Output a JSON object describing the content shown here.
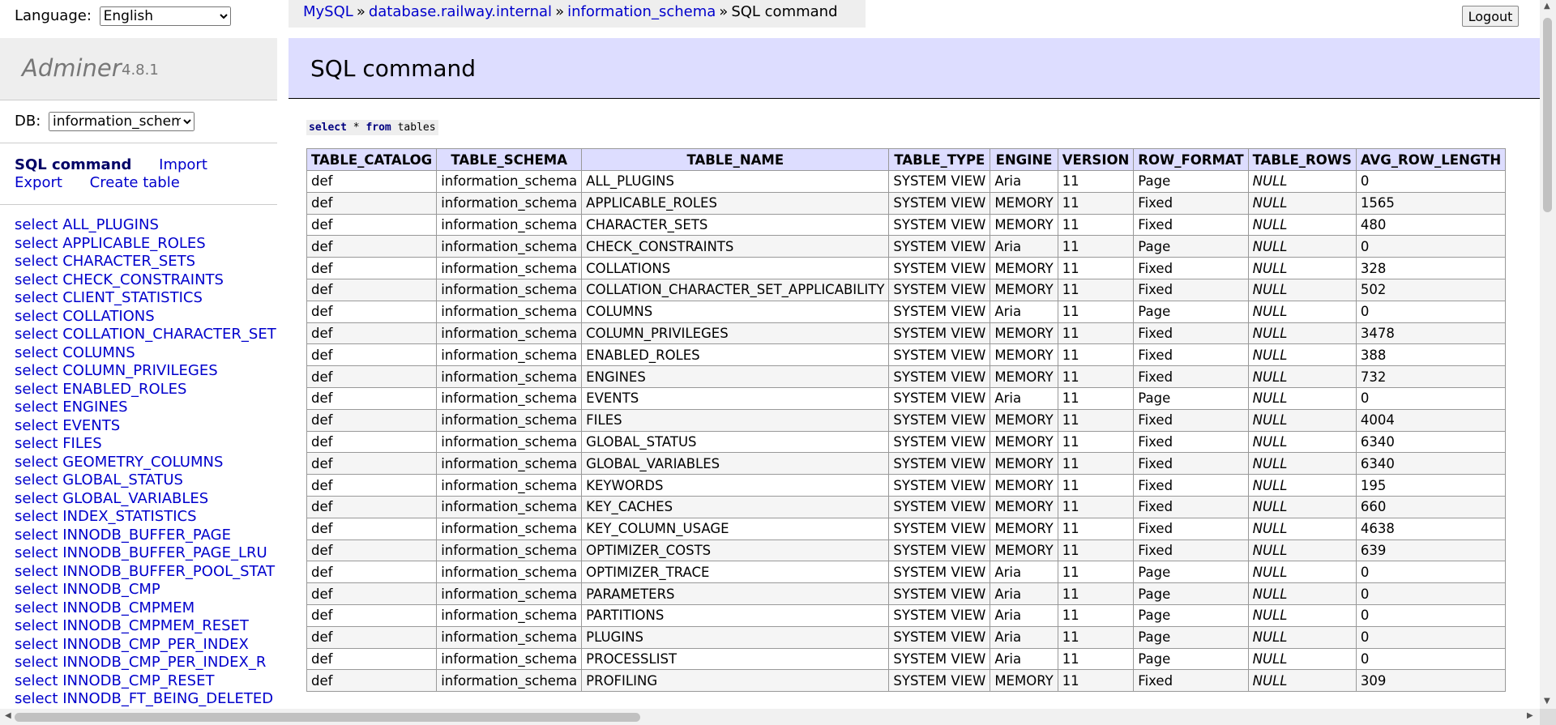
{
  "language": {
    "label": "Language:",
    "selected": "English"
  },
  "brand": {
    "name": "Adminer",
    "version": "4.8.1"
  },
  "db": {
    "label": "DB:",
    "selected": "information_schema"
  },
  "links": {
    "sql_command": "SQL command",
    "import": "Import",
    "export": "Export",
    "create_table": "Create table"
  },
  "sidebar_tables": [
    "select ALL_PLUGINS",
    "select APPLICABLE_ROLES",
    "select CHARACTER_SETS",
    "select CHECK_CONSTRAINTS",
    "select CLIENT_STATISTICS",
    "select COLLATIONS",
    "select COLLATION_CHARACTER_SET",
    "select COLUMNS",
    "select COLUMN_PRIVILEGES",
    "select ENABLED_ROLES",
    "select ENGINES",
    "select EVENTS",
    "select FILES",
    "select GEOMETRY_COLUMNS",
    "select GLOBAL_STATUS",
    "select GLOBAL_VARIABLES",
    "select INDEX_STATISTICS",
    "select INNODB_BUFFER_PAGE",
    "select INNODB_BUFFER_PAGE_LRU",
    "select INNODB_BUFFER_POOL_STAT",
    "select INNODB_CMP",
    "select INNODB_CMPMEM",
    "select INNODB_CMPMEM_RESET",
    "select INNODB_CMP_PER_INDEX",
    "select INNODB_CMP_PER_INDEX_R",
    "select INNODB_CMP_RESET",
    "select INNODB_FT_BEING_DELETED"
  ],
  "breadcrumb": {
    "mysql": "MySQL",
    "sep": "»",
    "server": "database.railway.internal",
    "db": "information_schema",
    "current": "SQL command"
  },
  "logout": "Logout",
  "heading": "SQL command",
  "query": {
    "kw_select": "select",
    "star": "*",
    "kw_from": "from",
    "table": "tables"
  },
  "table": {
    "columns": [
      "TABLE_CATALOG",
      "TABLE_SCHEMA",
      "TABLE_NAME",
      "TABLE_TYPE",
      "ENGINE",
      "VERSION",
      "ROW_FORMAT",
      "TABLE_ROWS",
      "AVG_ROW_LENGTH"
    ],
    "rows": [
      [
        "def",
        "information_schema",
        "ALL_PLUGINS",
        "SYSTEM VIEW",
        "Aria",
        "11",
        "Page",
        "NULL",
        "0"
      ],
      [
        "def",
        "information_schema",
        "APPLICABLE_ROLES",
        "SYSTEM VIEW",
        "MEMORY",
        "11",
        "Fixed",
        "NULL",
        "1565"
      ],
      [
        "def",
        "information_schema",
        "CHARACTER_SETS",
        "SYSTEM VIEW",
        "MEMORY",
        "11",
        "Fixed",
        "NULL",
        "480"
      ],
      [
        "def",
        "information_schema",
        "CHECK_CONSTRAINTS",
        "SYSTEM VIEW",
        "Aria",
        "11",
        "Page",
        "NULL",
        "0"
      ],
      [
        "def",
        "information_schema",
        "COLLATIONS",
        "SYSTEM VIEW",
        "MEMORY",
        "11",
        "Fixed",
        "NULL",
        "328"
      ],
      [
        "def",
        "information_schema",
        "COLLATION_CHARACTER_SET_APPLICABILITY",
        "SYSTEM VIEW",
        "MEMORY",
        "11",
        "Fixed",
        "NULL",
        "502"
      ],
      [
        "def",
        "information_schema",
        "COLUMNS",
        "SYSTEM VIEW",
        "Aria",
        "11",
        "Page",
        "NULL",
        "0"
      ],
      [
        "def",
        "information_schema",
        "COLUMN_PRIVILEGES",
        "SYSTEM VIEW",
        "MEMORY",
        "11",
        "Fixed",
        "NULL",
        "3478"
      ],
      [
        "def",
        "information_schema",
        "ENABLED_ROLES",
        "SYSTEM VIEW",
        "MEMORY",
        "11",
        "Fixed",
        "NULL",
        "388"
      ],
      [
        "def",
        "information_schema",
        "ENGINES",
        "SYSTEM VIEW",
        "MEMORY",
        "11",
        "Fixed",
        "NULL",
        "732"
      ],
      [
        "def",
        "information_schema",
        "EVENTS",
        "SYSTEM VIEW",
        "Aria",
        "11",
        "Page",
        "NULL",
        "0"
      ],
      [
        "def",
        "information_schema",
        "FILES",
        "SYSTEM VIEW",
        "MEMORY",
        "11",
        "Fixed",
        "NULL",
        "4004"
      ],
      [
        "def",
        "information_schema",
        "GLOBAL_STATUS",
        "SYSTEM VIEW",
        "MEMORY",
        "11",
        "Fixed",
        "NULL",
        "6340"
      ],
      [
        "def",
        "information_schema",
        "GLOBAL_VARIABLES",
        "SYSTEM VIEW",
        "MEMORY",
        "11",
        "Fixed",
        "NULL",
        "6340"
      ],
      [
        "def",
        "information_schema",
        "KEYWORDS",
        "SYSTEM VIEW",
        "MEMORY",
        "11",
        "Fixed",
        "NULL",
        "195"
      ],
      [
        "def",
        "information_schema",
        "KEY_CACHES",
        "SYSTEM VIEW",
        "MEMORY",
        "11",
        "Fixed",
        "NULL",
        "660"
      ],
      [
        "def",
        "information_schema",
        "KEY_COLUMN_USAGE",
        "SYSTEM VIEW",
        "MEMORY",
        "11",
        "Fixed",
        "NULL",
        "4638"
      ],
      [
        "def",
        "information_schema",
        "OPTIMIZER_COSTS",
        "SYSTEM VIEW",
        "MEMORY",
        "11",
        "Fixed",
        "NULL",
        "639"
      ],
      [
        "def",
        "information_schema",
        "OPTIMIZER_TRACE",
        "SYSTEM VIEW",
        "Aria",
        "11",
        "Page",
        "NULL",
        "0"
      ],
      [
        "def",
        "information_schema",
        "PARAMETERS",
        "SYSTEM VIEW",
        "Aria",
        "11",
        "Page",
        "NULL",
        "0"
      ],
      [
        "def",
        "information_schema",
        "PARTITIONS",
        "SYSTEM VIEW",
        "Aria",
        "11",
        "Page",
        "NULL",
        "0"
      ],
      [
        "def",
        "information_schema",
        "PLUGINS",
        "SYSTEM VIEW",
        "Aria",
        "11",
        "Page",
        "NULL",
        "0"
      ],
      [
        "def",
        "information_schema",
        "PROCESSLIST",
        "SYSTEM VIEW",
        "Aria",
        "11",
        "Page",
        "NULL",
        "0"
      ],
      [
        "def",
        "information_schema",
        "PROFILING",
        "SYSTEM VIEW",
        "MEMORY",
        "11",
        "Fixed",
        "NULL",
        "309"
      ]
    ]
  }
}
